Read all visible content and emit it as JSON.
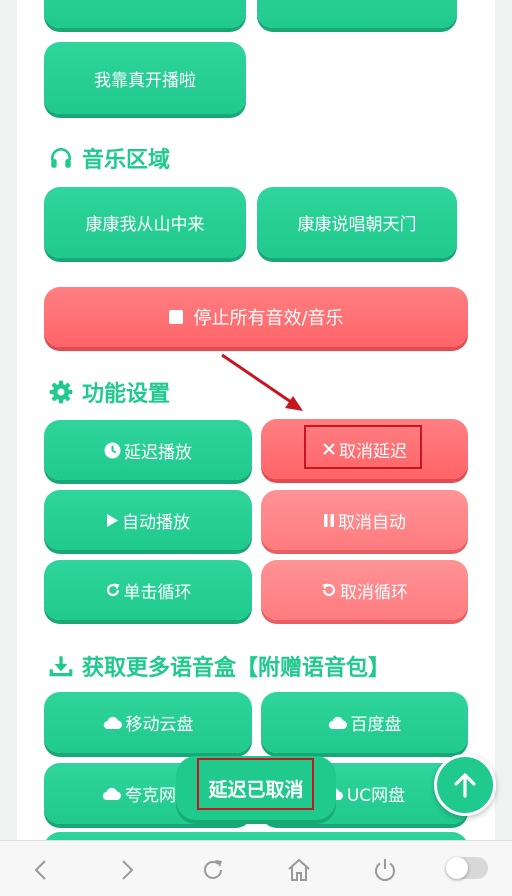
{
  "colors": {
    "accent": "#20c98d",
    "danger": "#ff6468",
    "highlight": "#c8161e"
  },
  "top": {
    "row1": [
      "",
      ""
    ],
    "row2": "我靠真开播啦"
  },
  "music": {
    "title": "音乐区域",
    "icon": "headphones-icon",
    "buttons": [
      "康康我从山中来",
      "康康说唱朝天门"
    ],
    "stop_button": "停止所有音效/音乐"
  },
  "settings": {
    "title": "功能设置",
    "icon": "gear-icon",
    "buttons": [
      {
        "label": "延迟播放",
        "icon": "clock-icon"
      },
      {
        "label": "取消延迟",
        "icon": "close-icon"
      },
      {
        "label": "自动播放",
        "icon": "play-icon"
      },
      {
        "label": "取消自动",
        "icon": "pause-icon"
      },
      {
        "label": "单击循环",
        "icon": "redo-icon"
      },
      {
        "label": "取消循环",
        "icon": "undo-icon"
      }
    ]
  },
  "downloads": {
    "title": "获取更多语音盒【附赠语音包】",
    "icon": "download-icon",
    "buttons": [
      {
        "label": "移动云盘",
        "icon": "cloud-icon"
      },
      {
        "label": "百度盘",
        "icon": "cloud-icon"
      },
      {
        "label": "夸克网",
        "icon": "cloud-icon"
      },
      {
        "label": "UC网盘",
        "icon": "cloud-icon"
      }
    ]
  },
  "toast": "延迟已取消",
  "browser_bar": [
    "back-icon",
    "forward-icon",
    "refresh-icon",
    "home-icon",
    "power-icon",
    "toggle"
  ]
}
